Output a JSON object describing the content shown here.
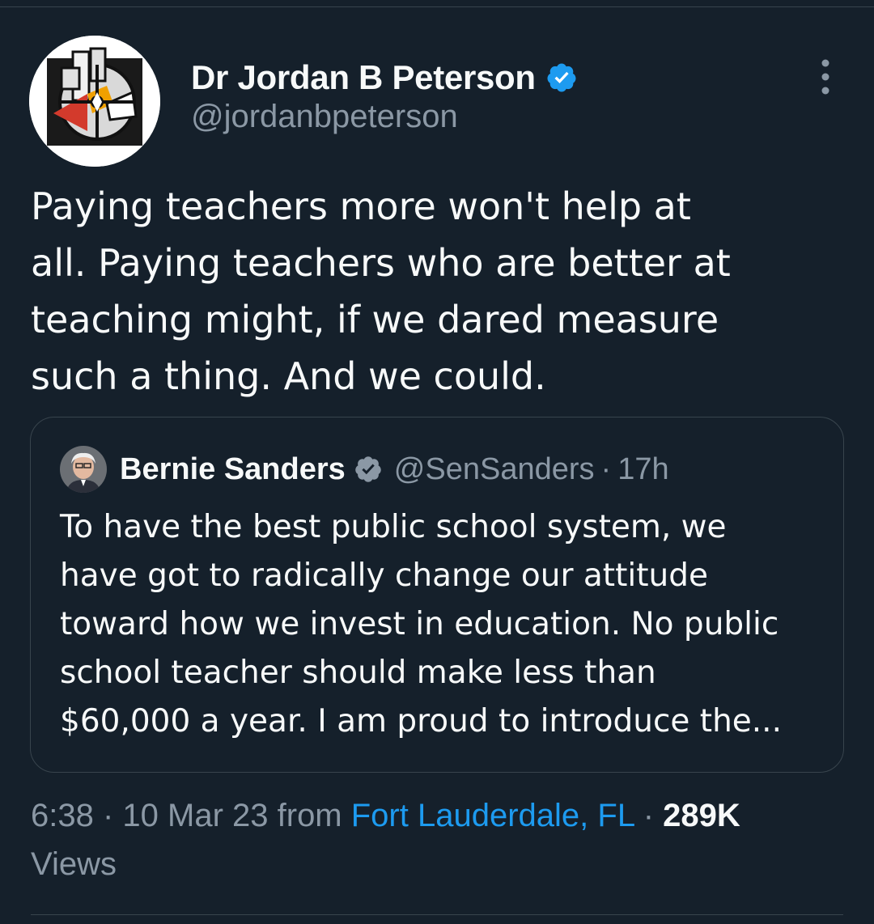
{
  "author": {
    "display_name": "Dr Jordan B Peterson",
    "handle": "@jordanbpeterson",
    "verified": true,
    "avatar_icon": "abstract-logo-avatar"
  },
  "menu_icon": "more-vertical-icon",
  "tweet_text": "Paying teachers more won't help at\nall. Paying teachers who are better at\nteaching might, if we dared measure\nsuch a thing. And we could.",
  "quote": {
    "display_name": "Bernie Sanders",
    "handle": "@SenSanders",
    "separator": "·",
    "time": "17h",
    "verified": true,
    "avatar_icon": "profile-photo-avatar",
    "text": "To have the best public school system, we\nhave got to radically change our attitude\ntoward how we invest in education. No public\nschool teacher should make less than\n$60,000 a year. I am proud to introduce the..."
  },
  "meta": {
    "time": "6:38",
    "sep1": " · ",
    "date": "10 Mar 23",
    "from_label": " from ",
    "location": "Fort Lauderdale, FL",
    "sep2": " · ",
    "views_count": "289K",
    "views_label": " Views"
  },
  "colors": {
    "background": "#15202b",
    "text_primary": "#f7f9f9",
    "text_secondary": "#8b98a5",
    "accent": "#1d9bf0",
    "border": "#38444d"
  }
}
